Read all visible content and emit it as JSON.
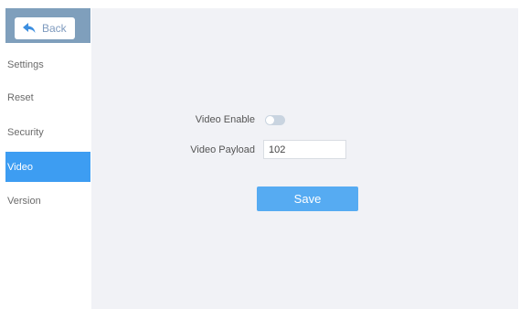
{
  "back": {
    "label": "Back",
    "icon": "back-arrow-icon"
  },
  "nav": {
    "items": [
      {
        "label": "Settings"
      },
      {
        "label": "Reset"
      },
      {
        "label": "Security"
      },
      {
        "label": "Video",
        "active": true
      },
      {
        "label": "Version"
      }
    ]
  },
  "form": {
    "video_enable": {
      "label": "Video Enable",
      "enabled": false
    },
    "video_payload": {
      "label": "Video Payload",
      "value": "102"
    },
    "save_label": "Save"
  },
  "colors": {
    "header": "#7f9fbc",
    "active_nav": "#3d9df2",
    "save_button": "#56abf2",
    "panel_bg": "#f1f2f6"
  }
}
